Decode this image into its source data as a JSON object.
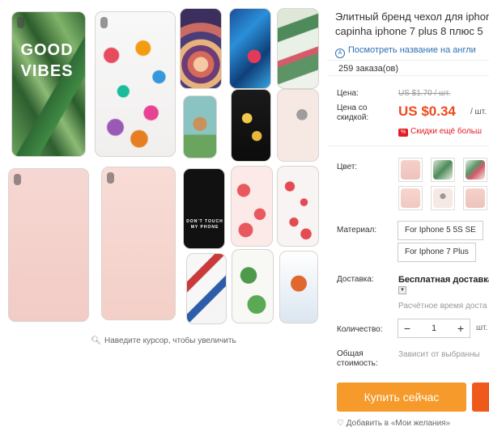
{
  "gallery": {
    "phone_texts": {
      "good_vibes": "GOOD VIBES",
      "black_case": "DON'T TOUCH MY PHONE"
    },
    "zoom_hint": "Наведите курсор, чтобы увеличить",
    "zoom_icon": "magnifier-icon"
  },
  "product": {
    "title_line1": "Элитный бренд чехол для iphone",
    "title_line2": "capinha iphone 7 plus 8 плюс 5",
    "translate_link": "Посмотреть название на англи",
    "orders": "259 заказа(ов)"
  },
  "price": {
    "label": "Цена:",
    "old": "US $1.70 / шт.",
    "discount_label": "Цена со скидкой:",
    "new": "US $0.34",
    "per_unit": "/ шт.",
    "discount_note": "Скидки ещё больш",
    "accent_color": "#ef4a1c"
  },
  "options": {
    "color_label": "Цвет:",
    "material_label": "Материал:",
    "materials": [
      "For Iphone 5 5S SE",
      "For Iphone 7 Plus"
    ]
  },
  "shipping": {
    "label": "Доставка:",
    "method": "Бесплатная доставка",
    "time": "Расчётное время доста"
  },
  "quantity": {
    "label": "Количество:",
    "minus": "−",
    "value": "1",
    "plus": "+",
    "unit": "шт."
  },
  "total": {
    "label": "Общая стоимость:",
    "note": "Зависит от выбранны"
  },
  "actions": {
    "buy_now": "Купить сейчас",
    "buy_color": "#f59a2b",
    "wishlist": "Добавить в «Мои желания»"
  }
}
